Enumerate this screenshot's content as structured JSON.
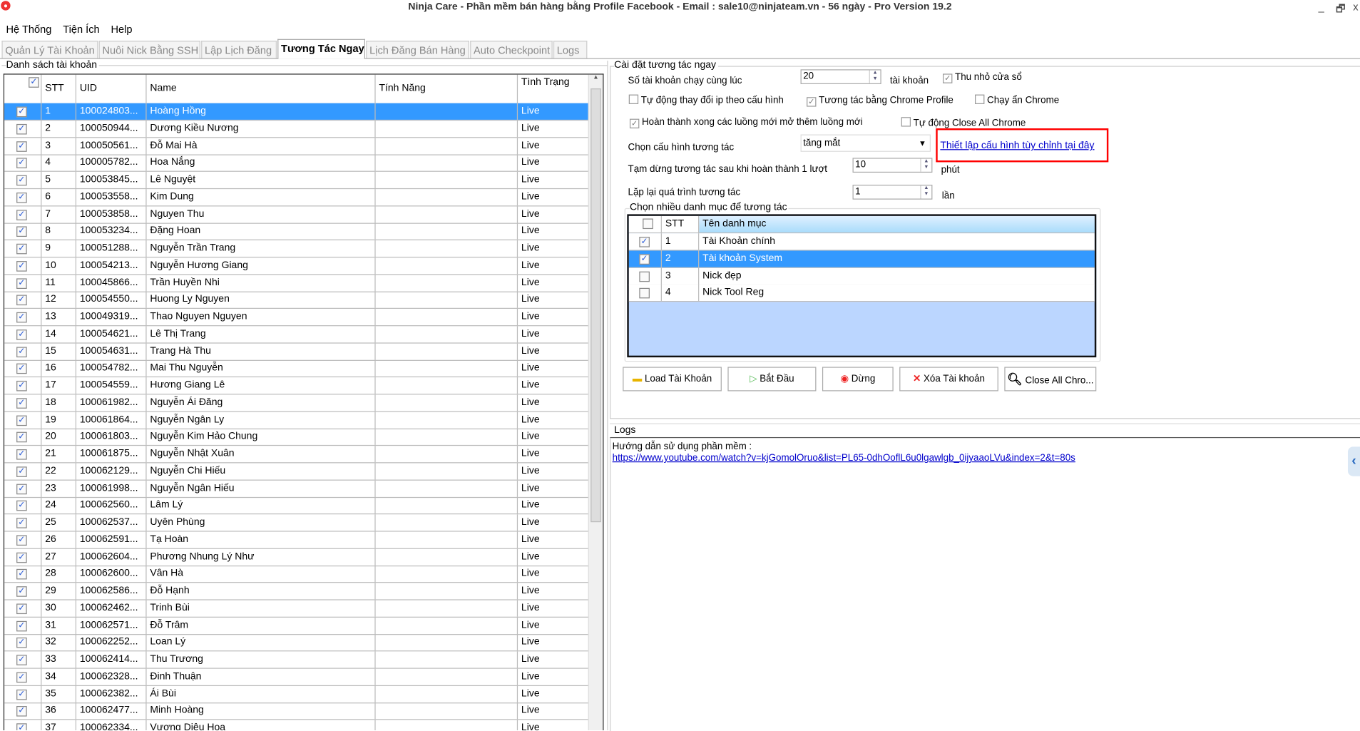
{
  "window": {
    "title": "Ninja Care - Phần mềm bán hàng bằng Profile Facebook - Email : sale10@ninjateam.vn - 56 ngày - Pro Version 19.2",
    "minimize": "_",
    "restore": "🗗",
    "close": "x"
  },
  "menu": [
    "Hệ Thống",
    "Tiện Ích",
    "Help"
  ],
  "tabs": [
    {
      "label": "Quản Lý Tài Khoản"
    },
    {
      "label": "Nuôi Nick Bằng SSH"
    },
    {
      "label": "Lập Lịch Đăng"
    },
    {
      "label": "Tương Tác Ngay",
      "active": true
    },
    {
      "label": "Lịch Đăng Bán Hàng"
    },
    {
      "label": "Auto Checkpoint"
    },
    {
      "label": "Logs"
    }
  ],
  "accounts": {
    "group_label": "Danh sách tài khoản",
    "columns": [
      "STT",
      "UID",
      "Name",
      "Tính Năng",
      "Tình Trạng"
    ],
    "selected_row": 1,
    "rows": [
      [
        "1",
        "100024803...",
        "Hoàng Hồng",
        "",
        "Live"
      ],
      [
        "2",
        "100050944...",
        "Dương Kiều Nương",
        "",
        "Live"
      ],
      [
        "3",
        "100050561...",
        "Đỗ Mai Hà",
        "",
        "Live"
      ],
      [
        "4",
        "100005782...",
        "Hoa Nắng",
        "",
        "Live"
      ],
      [
        "5",
        "100053845...",
        "Lê Nguyệt",
        "",
        "Live"
      ],
      [
        "6",
        "100053558...",
        "Kim Dung",
        "",
        "Live"
      ],
      [
        "7",
        "100053858...",
        "Nguyen Thu",
        "",
        "Live"
      ],
      [
        "8",
        "100053234...",
        "Đặng Hoan",
        "",
        "Live"
      ],
      [
        "9",
        "100051288...",
        "Nguyễn Trần Trang",
        "",
        "Live"
      ],
      [
        "10",
        "100054213...",
        "Nguyễn Hương Giang",
        "",
        "Live"
      ],
      [
        "11",
        "100045866...",
        "Trần Huyền Nhi",
        "",
        "Live"
      ],
      [
        "12",
        "100054550...",
        "Huong Ly Nguyen",
        "",
        "Live"
      ],
      [
        "13",
        "100049319...",
        "Thao Nguyen Nguyen",
        "",
        "Live"
      ],
      [
        "14",
        "100054621...",
        "Lê Thị Trang",
        "",
        "Live"
      ],
      [
        "15",
        "100054631...",
        "Trang Hà Thu",
        "",
        "Live"
      ],
      [
        "16",
        "100054782...",
        "Mai Thu Nguyễn",
        "",
        "Live"
      ],
      [
        "17",
        "100054559...",
        "Hương Giang Lê",
        "",
        "Live"
      ],
      [
        "18",
        "100061982...",
        "Nguyễn Ái Đăng",
        "",
        "Live"
      ],
      [
        "19",
        "100061864...",
        "Nguyễn Ngân Ly",
        "",
        "Live"
      ],
      [
        "20",
        "100061803...",
        "Nguyễn Kim Hảo Chung",
        "",
        "Live"
      ],
      [
        "21",
        "100061875...",
        "Nguyễn Nhật Xuân",
        "",
        "Live"
      ],
      [
        "22",
        "100062129...",
        "Nguyễn Chi Hiếu",
        "",
        "Live"
      ],
      [
        "23",
        "100061998...",
        "Nguyễn Ngân Hiếu",
        "",
        "Live"
      ],
      [
        "24",
        "100062560...",
        "Lâm Lý",
        "",
        "Live"
      ],
      [
        "25",
        "100062537...",
        "Uyên Phùng",
        "",
        "Live"
      ],
      [
        "26",
        "100062591...",
        "Tạ Hoàn",
        "",
        "Live"
      ],
      [
        "27",
        "100062604...",
        "Phương Nhung Lý Như",
        "",
        "Live"
      ],
      [
        "28",
        "100062600...",
        "Vân Hà",
        "",
        "Live"
      ],
      [
        "29",
        "100062586...",
        "Đỗ Hạnh",
        "",
        "Live"
      ],
      [
        "30",
        "100062462...",
        "Trinh Bùi",
        "",
        "Live"
      ],
      [
        "31",
        "100062571...",
        "Đỗ Trâm",
        "",
        "Live"
      ],
      [
        "32",
        "100062252...",
        "Loan Lý",
        "",
        "Live"
      ],
      [
        "33",
        "100062414...",
        "Thu Trương",
        "",
        "Live"
      ],
      [
        "34",
        "100062328...",
        "Đinh Thuận",
        "",
        "Live"
      ],
      [
        "35",
        "100062382...",
        "Ái Bùi",
        "",
        "Live"
      ],
      [
        "36",
        "100062477...",
        "Minh Hoàng",
        "",
        "Live"
      ],
      [
        "37",
        "100062334...",
        "Vương Diệu Hoa",
        "",
        "Live"
      ]
    ]
  },
  "settings": {
    "group_label": "Cài đặt tương tác ngay",
    "concurrent_label": "Số tài khoản chạy cùng lúc",
    "concurrent_value": "20",
    "concurrent_unit": "tài khoản",
    "minimize_window": {
      "label": "Thu nhỏ cửa sổ",
      "checked": true
    },
    "auto_change_ip": {
      "label": "Tự động thay đổi ip theo cấu hình",
      "checked": false
    },
    "chrome_profile": {
      "label": "Tương tác bằng Chrome Profile",
      "checked": true
    },
    "hide_chrome": {
      "label": "Chạy ẩn Chrome",
      "checked": false
    },
    "finish_threads": {
      "label": "Hoàn thành xong các luồng mới mở thêm luồng mới",
      "checked": true
    },
    "auto_close_chrome": {
      "label": "Tự động Close All Chrome",
      "checked": false
    },
    "config_label": "Chọn cấu hình tương tác",
    "config_value": "tăng mắt",
    "custom_config_link": "Thiết lập cấu hình tùy chỉnh tại đây",
    "highlight_color": "#ff0000",
    "pause_label": "Tạm dừng tương tác sau khi hoàn thành 1 lượt",
    "pause_value": "10",
    "pause_unit": "phút",
    "repeat_label": "Lặp lại quá trình tương tác",
    "repeat_value": "1",
    "repeat_unit": "lần"
  },
  "categories": {
    "group_label": "Chọn nhiều danh mục để tương tác",
    "columns": [
      "STT",
      "Tên danh mục"
    ],
    "rows": [
      {
        "stt": "1",
        "name": "Tài Khoản chính",
        "checked": true
      },
      {
        "stt": "2",
        "name": "Tài khoản System",
        "checked": true,
        "selected": true
      },
      {
        "stt": "3",
        "name": "Nick đẹp",
        "checked": false
      },
      {
        "stt": "4",
        "name": "Nick Tool Reg",
        "checked": false
      }
    ]
  },
  "buttons": [
    {
      "label": "Load Tài Khoản",
      "icon": "folder-icon"
    },
    {
      "label": "Bắt Đầu",
      "icon": "play-icon"
    },
    {
      "label": "Dừng",
      "icon": "stop-icon"
    },
    {
      "label": "Xóa Tài khoản",
      "icon": "delete-x-icon"
    },
    {
      "label": "Close All Chro...",
      "icon": "search-icon"
    }
  ],
  "logs": {
    "group_label": "Logs",
    "line1": "Hướng dẫn sử dụng phần mềm :",
    "link": "https://www.youtube.com/watch?v=kjGomolOruo&list=PL65-0dhOoflL6u0lgawlgb_0ijyaaoLVu&index=2&t=80s"
  },
  "colors": {
    "selection": "#3399ff",
    "category_bg": "#bbd6ff",
    "link": "#0000cc"
  }
}
